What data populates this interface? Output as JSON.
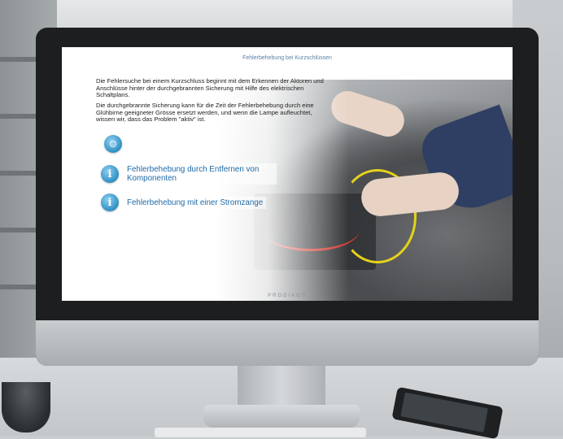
{
  "screen": {
    "title": "Fehlerbehebung bei Kurzschlüssen",
    "paragraphs": [
      "Die Fehlersuche bei einem Kurzschluss beginnt mit dem Erkennen der Aktoren und Anschlüsse hinter der durchgebrannten Sicherung mit Hilfe des elektrischen Schaltplans.",
      "Die durchgebrannte Sicherung kann für die Zeit der Fehlerbehebung durch eine Glühbirne geeigneter Grösse ersetzt werden, und wenn die Lampe aufleuchtet, wissen wir, dass das Problem \"aktiv\" ist."
    ],
    "links": [
      {
        "label": "Fehlerbehebung durch Entfernen von Komponenten",
        "icon": "info-icon"
      },
      {
        "label": "Fehlerbehebung mit einer Stromzange",
        "icon": "info-icon"
      }
    ],
    "top_icon": "smiley-icon",
    "logo": "PRODIAGS",
    "colors": {
      "accent": "#2f8fc4",
      "link": "#1f6aa8",
      "title": "#5b80a6"
    }
  }
}
